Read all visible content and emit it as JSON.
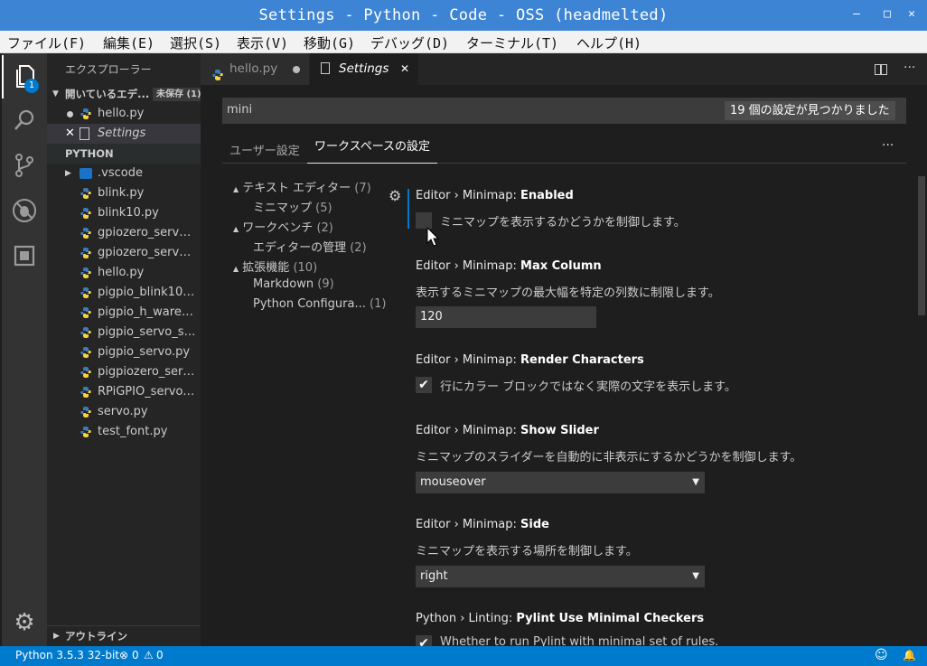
{
  "window": {
    "title": "Settings - Python - Code - OSS (headmelted)",
    "minimize": "—",
    "maximize": "□",
    "close": "✕"
  },
  "menu": [
    "ファイル(F)",
    "編集(E)",
    "選択(S)",
    "表示(V)",
    "移動(G)",
    "デバッグ(D)",
    "ターミナル(T)",
    "ヘルプ(H)"
  ],
  "activity": {
    "explorer_badge": "1"
  },
  "sidebar": {
    "title": "エクスプローラー",
    "open_editors": {
      "label": "開いているエデ...",
      "badge": "未保存 (1)",
      "items": [
        "hello.py",
        "Settings"
      ]
    },
    "folder": "PYTHON",
    "files": [
      ".vscode",
      "blink.py",
      "blink10.py",
      "gpiozero_servo_...",
      "gpiozero_servo_f...",
      "hello.py",
      "pigpio_blink10.py",
      "pigpio_h_ware_s...",
      "pigpio_servo_ser...",
      "pigpio_servo.py",
      "pigpiozero_servo...",
      "RPiGPIO_servo.py",
      "servo.py",
      "test_font.py"
    ],
    "outline": "アウトライン"
  },
  "tabs": [
    {
      "label": "hello.py"
    },
    {
      "label": "Settings"
    }
  ],
  "search": {
    "value": "mini",
    "result": "19 個の設定が見つかりました"
  },
  "settings_tabs": {
    "user": "ユーザー設定",
    "workspace": "ワークスペースの設定",
    "more": "···"
  },
  "toc": [
    {
      "label": "テキスト エディター",
      "count": "(7)"
    },
    {
      "label": "ミニマップ",
      "count": "(5)"
    },
    {
      "label": "ワークベンチ",
      "count": "(2)"
    },
    {
      "label": "エディターの管理",
      "count": "(2)"
    },
    {
      "label": "拡張機能",
      "count": "(10)"
    },
    {
      "label": "Markdown",
      "count": "(9)"
    },
    {
      "label": "Python Configura...",
      "count": "(1)"
    }
  ],
  "settings": [
    {
      "prefix": "Editor › Minimap: ",
      "name": "Enabled",
      "desc": "ミニマップを表示するかどうかを制御します。",
      "checked": false
    },
    {
      "prefix": "Editor › Minimap: ",
      "name": "Max Column",
      "desc": "表示するミニマップの最大幅を特定の列数に制限します。",
      "value": "120"
    },
    {
      "prefix": "Editor › Minimap: ",
      "name": "Render Characters",
      "desc": "行にカラー ブロックではなく実際の文字を表示します。",
      "checked": true
    },
    {
      "prefix": "Editor › Minimap: ",
      "name": "Show Slider",
      "desc": "ミニマップのスライダーを自動的に非表示にするかどうかを制御します。",
      "value": "mouseover"
    },
    {
      "prefix": "Editor › Minimap: ",
      "name": "Side",
      "desc": "ミニマップを表示する場所を制御します。",
      "value": "right"
    },
    {
      "prefix": "Python › Linting: ",
      "name": "Pylint Use Minimal Checkers",
      "desc": "Whether to run Pylint with minimal set of rules.",
      "checked": true
    }
  ],
  "status": {
    "python": "Python 3.5.3 32-bit",
    "errors": "0",
    "warnings": "0"
  },
  "colors": {
    "accent": "#007acc",
    "titlebar": "#3d84d4",
    "activity": "#333333",
    "sidebar": "#252526",
    "editor": "#1e1e1e"
  }
}
